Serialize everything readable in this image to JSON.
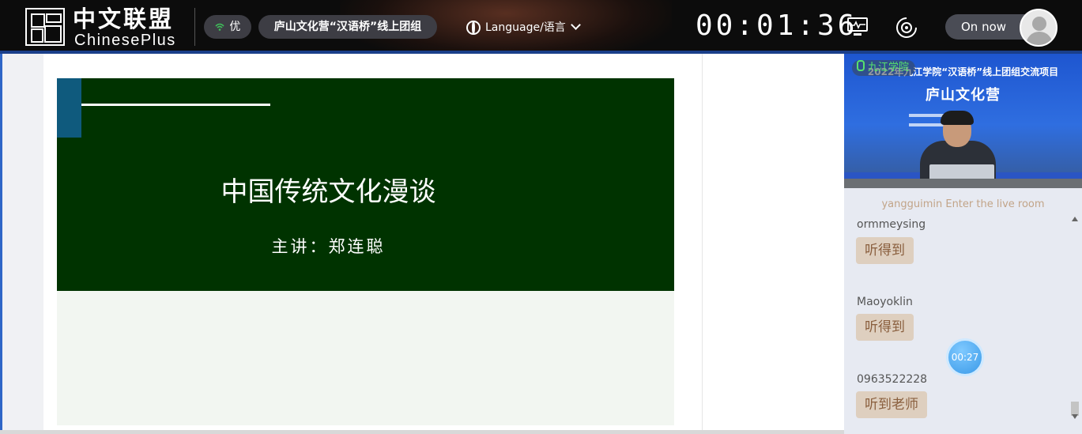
{
  "header": {
    "logo_cn": "中文联盟",
    "logo_en": "ChinesePlus",
    "signal_label": "优",
    "room_title": "庐山文化营“汉语桥”线上团组",
    "language_label": "Language/语言",
    "timer": "00:01:36",
    "status_label": "On now"
  },
  "slide": {
    "title": "中国传统文化漫谈",
    "speaker": "主讲：郑连聪"
  },
  "video": {
    "source_label": "九江学院",
    "banner_line1": "2022年九江学院“汉语桥”线上团组交流项目",
    "banner_line2": "庐山文化营"
  },
  "chat": {
    "system_message": "yangguimin Enter the live room",
    "messages": [
      {
        "user": "ormmeysing",
        "text": "听得到"
      },
      {
        "user": "Maoyoklin",
        "text": "听得到"
      },
      {
        "user": "0963522228",
        "text": "听到老师"
      }
    ]
  },
  "floating_timer": "00:27",
  "colors": {
    "topbar_bg": "#0c0c0c",
    "slide_bg": "#003300",
    "slide_accent": "#0f5a7d",
    "chat_bubble": "#decfbf",
    "chat_text": "#8a5f3e",
    "signal_green": "#3fbf5a"
  }
}
